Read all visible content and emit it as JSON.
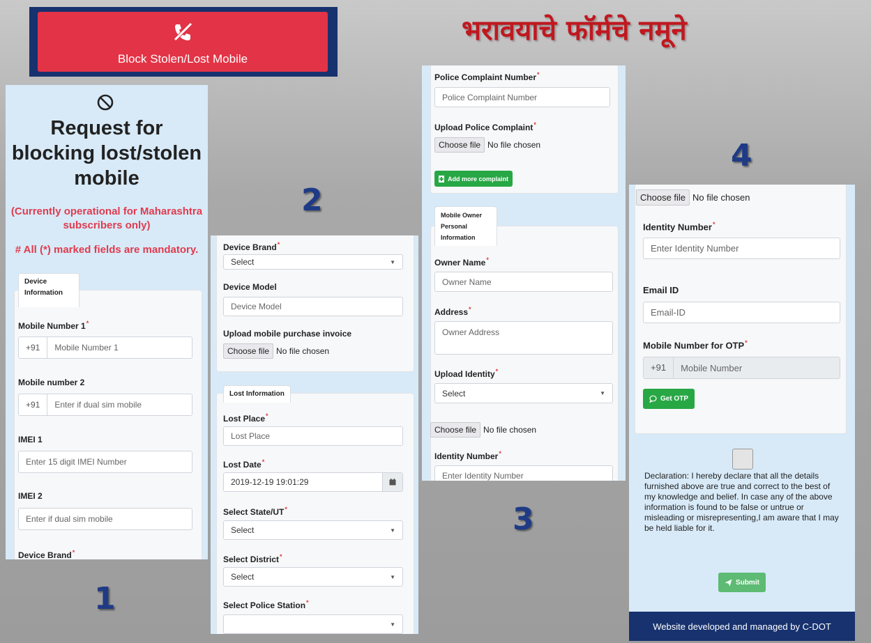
{
  "banner": {
    "label": "Block Stolen/Lost Mobile",
    "icon": "phone-slash-icon",
    "color": "#e33346",
    "frame": "#17326e"
  },
  "marathi_heading": "भरावयाचे फॉर्मचे नमूने",
  "steps": [
    "1",
    "2",
    "3",
    "4"
  ],
  "panel1": {
    "ban_icon": "⃠",
    "title_lines": [
      "Request for",
      "blocking lost/stolen",
      "mobile"
    ],
    "notice_lines": [
      "(Currently operational for Maharashtra",
      "subscribers only)"
    ],
    "mandatory": "# All (*) marked fields are mandatory.",
    "tab_lines": [
      "Device",
      "Information"
    ],
    "mobile1_label": "Mobile Number 1",
    "mobile1_prefix": "+91",
    "mobile1_placeholder": "Mobile Number 1",
    "mobile2_label": "Mobile number 2",
    "mobile2_prefix": "+91",
    "mobile2_placeholder": "Enter if dual sim mobile",
    "imei1_label": "IMEI 1",
    "imei1_placeholder": "Enter 15 digit IMEI Number",
    "imei2_label": "IMEI 2",
    "imei2_placeholder": "Enter if dual sim mobile",
    "brand_label": "Device Brand"
  },
  "panel2": {
    "brand_label": "Device Brand",
    "brand_value": "Select",
    "model_label": "Device Model",
    "model_placeholder": "Device Model",
    "invoice_label": "Upload mobile purchase invoice",
    "file_btn": "Choose file",
    "file_status": "No file chosen",
    "lost_tab": "Lost Information",
    "place_label": "Lost Place",
    "place_placeholder": "Lost Place",
    "date_label": "Lost Date",
    "date_value": "2019-12-19 19:01:29",
    "state_label": "Select State/UT",
    "state_value": "Select",
    "district_label": "Select District",
    "district_value": "Select",
    "police_label": "Select Police Station",
    "police_value": ""
  },
  "panel3": {
    "complaint_label": "Police Complaint Number",
    "complaint_placeholder": "Police Complaint Number",
    "upload_label": "Upload Police Complaint",
    "file_btn": "Choose file",
    "file_status": "No file chosen",
    "add_btn": "Add more complaint",
    "owner_tab_lines": [
      "Mobile Owner",
      "Personal",
      "Information"
    ],
    "owner_label": "Owner Name",
    "owner_placeholder": "Owner Name",
    "address_label": "Address",
    "address_placeholder": "Owner Address",
    "identity_upload_label": "Upload Identity",
    "identity_select": "Select",
    "file2_btn": "Choose file",
    "file2_status": "No file chosen",
    "identity_label": "Identity Number",
    "identity_placeholder": "Enter Identity Number"
  },
  "panel4": {
    "file_btn": "Choose file",
    "file_status": "No file chosen",
    "identity_label": "Identity Number",
    "identity_placeholder": "Enter Identity Number",
    "email_label": "Email ID",
    "email_placeholder": "Email-ID",
    "otp_label": "Mobile Number for OTP",
    "otp_prefix": "+91",
    "otp_placeholder": "Mobile Number",
    "get_otp": "Get OTP",
    "declaration": "Declaration: I hereby declare that all the details furnished above are true and correct to the best of my knowledge and belief. In case any of the above information is found to be false or untrue or misleading or misrepresenting,I am aware that I may be held liable for it.",
    "submit": "Submit",
    "footer": "Website developed and managed by C-DOT"
  }
}
